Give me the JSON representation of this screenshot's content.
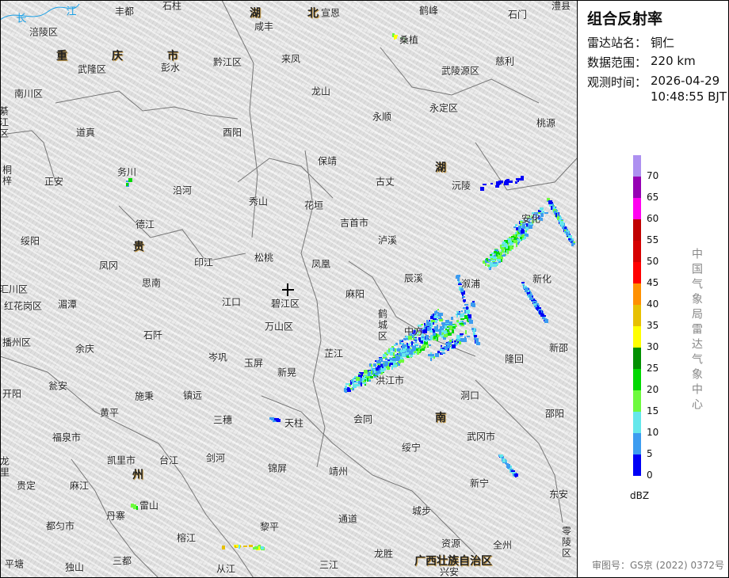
{
  "panel": {
    "title": "组合反射率",
    "station_label": "雷达站名：",
    "station_value": "铜仁",
    "range_label": "数据范围：",
    "range_value": "220 km",
    "time_label": "观测时间：",
    "time_date": "2026-04-29",
    "time_clock": "10:48:55 BJT",
    "agency": "中国气象局雷达气象中心",
    "unit": "dBZ",
    "footer": "审图号：GS京 (2022) 0372号"
  },
  "legend": [
    {
      "value": "0",
      "color": "#0000f6"
    },
    {
      "value": "5",
      "color": "#3c9cf0"
    },
    {
      "value": "10",
      "color": "#64e7eb"
    },
    {
      "value": "15",
      "color": "#6dfa3d"
    },
    {
      "value": "20",
      "color": "#00d800"
    },
    {
      "value": "25",
      "color": "#019000"
    },
    {
      "value": "30",
      "color": "#ffff00"
    },
    {
      "value": "35",
      "color": "#e7c000"
    },
    {
      "value": "40",
      "color": "#ff9000"
    },
    {
      "value": "45",
      "color": "#ff0000"
    },
    {
      "value": "50",
      "color": "#d60000"
    },
    {
      "value": "55",
      "color": "#c00000"
    },
    {
      "value": "60",
      "color": "#ff00f0"
    },
    {
      "value": "65",
      "color": "#9600b4"
    },
    {
      "value": "70",
      "color": "#ad90f0"
    }
  ],
  "places": [
    "丰都",
    "石柱",
    "湖",
    "北",
    "宣恩",
    "咸丰",
    "鹤峰",
    "石门",
    "澧县",
    "涪陵区",
    "长",
    "江",
    "重",
    "庆",
    "市",
    "武隆区",
    "彭水",
    "黔江区",
    "来凤",
    "桑植",
    "慈利",
    "武陵源区",
    "南川区",
    "龙山",
    "永定区",
    "永顺",
    "桃源",
    "道真",
    "酉阳",
    "綦江区",
    "桐梓",
    "正安",
    "务川",
    "沿河",
    "保靖",
    "湖",
    "古丈",
    "沅陵",
    "秀山",
    "花垣",
    "吉首市",
    "泸溪",
    "德江",
    "贵",
    "绥阳",
    "凤冈",
    "印江",
    "松桃",
    "凤凰",
    "辰溪",
    "溆浦",
    "安化",
    "新化",
    "思南",
    "汇川区",
    "红花岗区",
    "湄潭",
    "江口",
    "碧江区",
    "麻阳",
    "鹤城区",
    "中方",
    "万山区",
    "石阡",
    "播州区",
    "余庆",
    "岑巩",
    "玉屏",
    "芷江",
    "隆回",
    "新邵",
    "新晃",
    "开阳",
    "瓮安",
    "施秉",
    "镇远",
    "洪江市",
    "洞口",
    "黄平",
    "三穗",
    "天柱",
    "会同",
    "南",
    "邵阳",
    "福泉市",
    "武冈市",
    "绥宁",
    "凯里市",
    "台江",
    "剑河",
    "龙里",
    "州",
    "锦屏",
    "靖州",
    "贵定",
    "麻江",
    "新宁",
    "东安",
    "雷山",
    "丹寨",
    "都匀市",
    "黎平",
    "通道",
    "城步",
    "榕江",
    "零陵区",
    "资源",
    "全州",
    "平塘",
    "独山",
    "三都",
    "从江",
    "龙胜",
    "三江",
    "广西壮族自治区",
    "兴安"
  ]
}
